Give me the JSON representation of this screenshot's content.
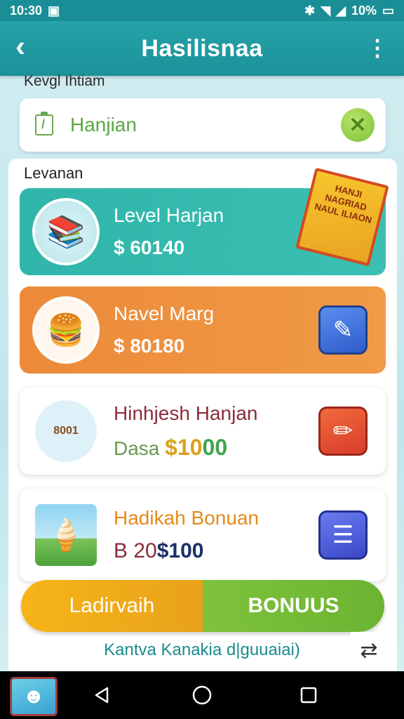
{
  "statusbar": {
    "time": "10:30",
    "battery": "10%"
  },
  "appbar": {
    "title": "Hasilisnaa"
  },
  "top_label": "Kevgl Ihtiam",
  "search": {
    "value": "Hanjian"
  },
  "panel": {
    "label": "Levanan"
  },
  "cards": [
    {
      "name": "Level Harjan",
      "price": "$ 60140",
      "action_icon": "shop-icon"
    },
    {
      "name": "Navel Marg",
      "price": "$ 80180",
      "action_icon": "tag-icon"
    },
    {
      "name": "Hinhjesh Hanjan",
      "price_prefix": "Dasa ",
      "price_amt": "$10",
      "price_amt0": "00",
      "action_icon": "pencil-icon"
    },
    {
      "name": "Hadikah Bonuan",
      "price_prefix": "B 20",
      "price_amt": "$100",
      "action_icon": "note-icon"
    }
  ],
  "poster_text": "HANJI NAGRIAD NAUL ILIAON",
  "card3_badge": "8001",
  "bonus": {
    "left_label": "Ladirvaih",
    "right_label": "BONUUS"
  },
  "footer": {
    "link_text": "Kantva Kanakia d|guuaiai)"
  }
}
